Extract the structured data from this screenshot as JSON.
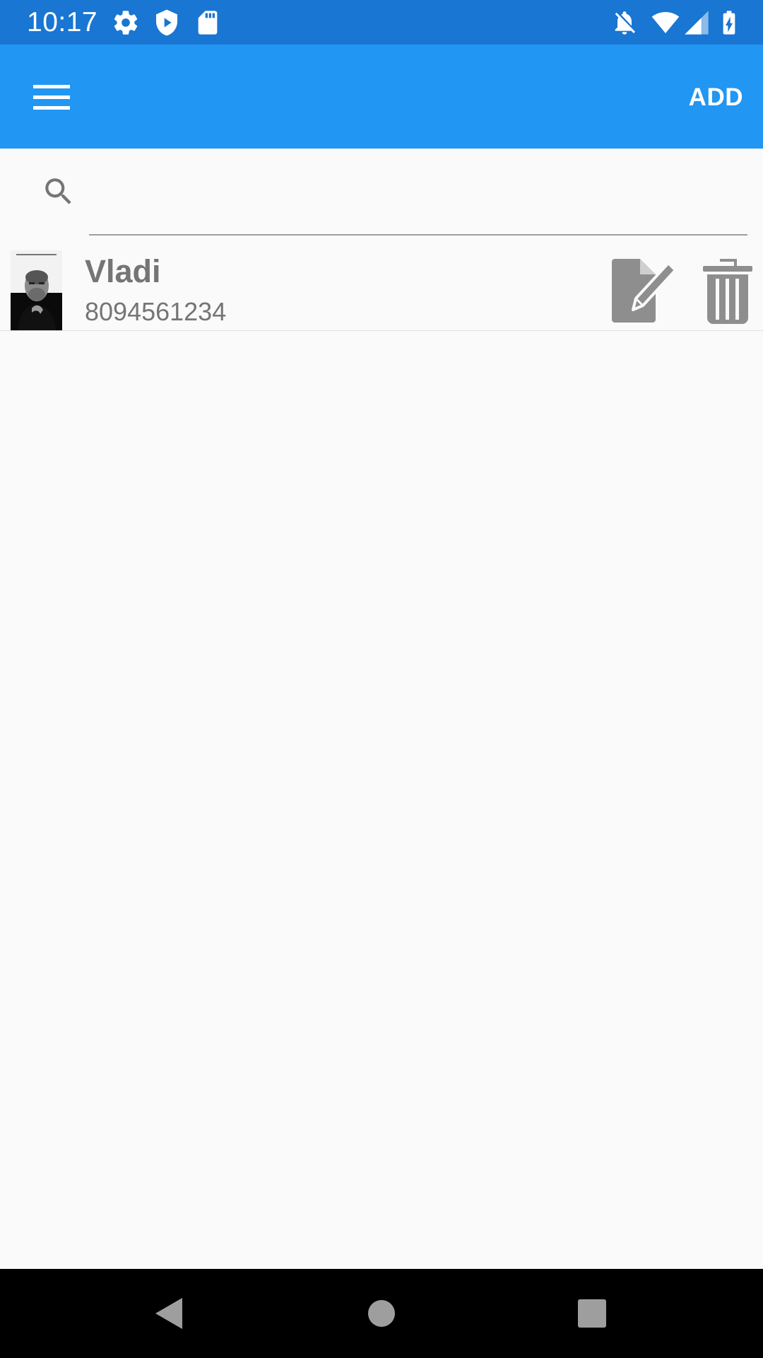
{
  "status_bar": {
    "time": "10:17",
    "left_icons": [
      "gear-icon",
      "shield-icon",
      "sd-card-icon"
    ],
    "right_icons": [
      "notifications-off-icon",
      "wifi-icon",
      "signal-icon",
      "battery-charging-icon"
    ]
  },
  "app_bar": {
    "menu_icon": "hamburger-menu-icon",
    "add_label": "ADD",
    "background_color": "#2196f3"
  },
  "search": {
    "icon": "search-icon",
    "value": "",
    "placeholder": ""
  },
  "contacts": [
    {
      "name": "Vladi",
      "phone": "8094561234",
      "avatar": "contact-photo",
      "actions": [
        "edit-icon",
        "delete-icon"
      ]
    }
  ],
  "nav_bar": {
    "buttons": [
      "back-icon",
      "home-icon",
      "recents-icon"
    ]
  },
  "colors": {
    "status_bar": "#1976d2",
    "app_bar": "#2196f3",
    "text_secondary": "#757575",
    "icon_gray": "#8e8e8e",
    "background": "#fafafa"
  }
}
